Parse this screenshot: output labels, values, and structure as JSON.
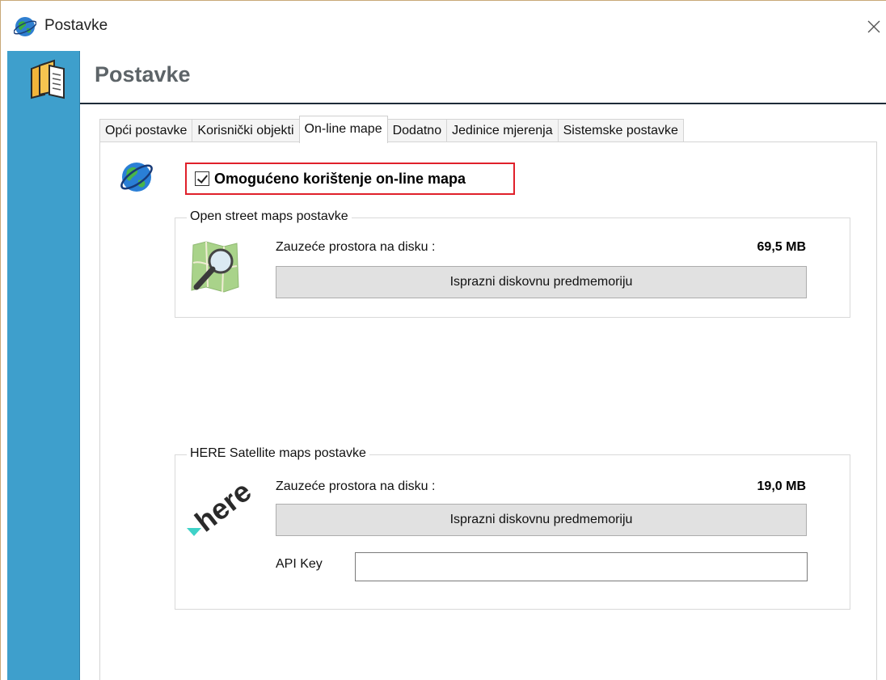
{
  "window": {
    "title": "Postavke",
    "title_icon": "globe-icon",
    "close_icon": "close-icon"
  },
  "header": {
    "title": "Postavke",
    "logo_icon": "folder-book-icon"
  },
  "tabs": [
    {
      "label": "Opći postavke",
      "active": false
    },
    {
      "label": "Korisnički objekti",
      "active": false
    },
    {
      "label": "On-line mape",
      "active": true
    },
    {
      "label": "Dodatno",
      "active": false
    },
    {
      "label": "Jedinice mjerenja",
      "active": false
    },
    {
      "label": "Sistemske postavke",
      "active": false
    }
  ],
  "online_maps": {
    "enable_label": "Omogućeno korištenje on-line mapa",
    "enabled": true,
    "highlight_color": "#e0202a"
  },
  "osm": {
    "legend": "Open street maps postavke",
    "disk_label": "Zauzeće prostora na disku :",
    "disk_value": "69,5 MB",
    "clear_button": "Isprazni diskovnu predmemoriju"
  },
  "here": {
    "legend": "HERE Satellite maps postavke",
    "disk_label": "Zauzeće prostora na disku :",
    "disk_value": "19,0 MB",
    "clear_button": "Isprazni diskovnu predmemoriju",
    "api_key_label": "API Key",
    "api_key_value": "",
    "logo_text": "here"
  },
  "colors": {
    "sidebar": "#3e9fcc",
    "header_rule": "#1f2b38"
  }
}
